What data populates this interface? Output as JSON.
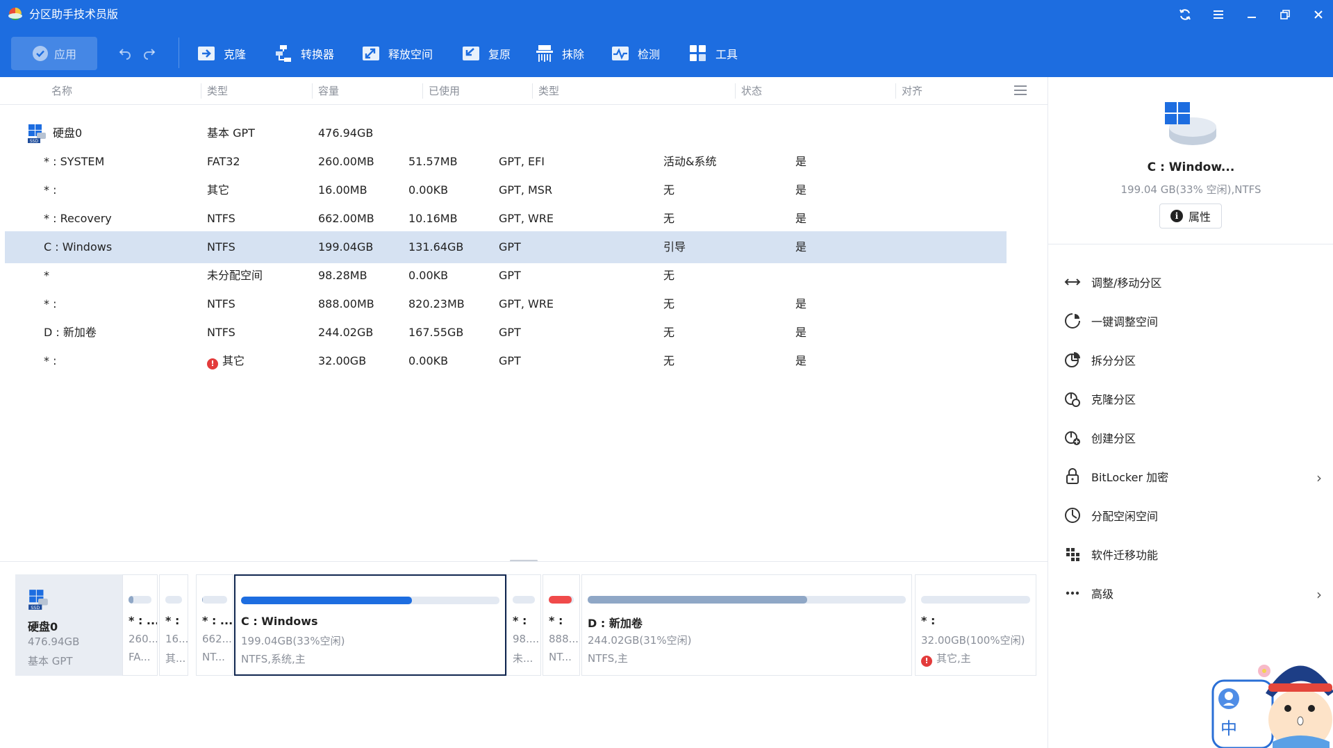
{
  "app": {
    "title": "分区助手技术员版"
  },
  "toolbar": {
    "apply": "应用",
    "tools": [
      {
        "id": "clone",
        "label": "克隆"
      },
      {
        "id": "converter",
        "label": "转换器"
      },
      {
        "id": "free-space",
        "label": "释放空间"
      },
      {
        "id": "restore",
        "label": "复原"
      },
      {
        "id": "wipe",
        "label": "抹除"
      },
      {
        "id": "check",
        "label": "检测"
      },
      {
        "id": "tools",
        "label": "工具"
      }
    ]
  },
  "columns": [
    "名称",
    "类型",
    "容量",
    "已使用",
    "类型",
    "状态",
    "对齐"
  ],
  "disk": {
    "name": "硬盘0",
    "type": "基本 GPT",
    "capacity": "476.94GB",
    "badge": "SSD"
  },
  "partitions": [
    {
      "name": "* : SYSTEM",
      "fs": "FAT32",
      "capacity": "260.00MB",
      "used": "51.57MB",
      "ptype": "GPT, EFI",
      "status": "活动&系统",
      "align": "是"
    },
    {
      "name": "* :",
      "fs": "其它",
      "capacity": "16.00MB",
      "used": "0.00KB",
      "ptype": "GPT, MSR",
      "status": "无",
      "align": "是"
    },
    {
      "name": "* : Recovery",
      "fs": "NTFS",
      "capacity": "662.00MB",
      "used": "10.16MB",
      "ptype": "GPT, WRE",
      "status": "无",
      "align": "是"
    },
    {
      "name": "C : Windows",
      "fs": "NTFS",
      "capacity": "199.04GB",
      "used": "131.64GB",
      "ptype": "GPT",
      "status": "引导",
      "align": "是",
      "selected": true
    },
    {
      "name": "*",
      "fs": "未分配空间",
      "capacity": "98.28MB",
      "used": "0.00KB",
      "ptype": "GPT",
      "status": "无",
      "align": ""
    },
    {
      "name": "* :",
      "fs": "NTFS",
      "capacity": "888.00MB",
      "used": "820.23MB",
      "ptype": "GPT, WRE",
      "status": "无",
      "align": "是"
    },
    {
      "name": "D : 新加卷",
      "fs": "NTFS",
      "capacity": "244.02GB",
      "used": "167.55GB",
      "ptype": "GPT",
      "status": "无",
      "align": "是"
    },
    {
      "name": "* :",
      "fs": "其它",
      "capacity": "32.00GB",
      "used": "0.00KB",
      "ptype": "GPT",
      "status": "无",
      "align": "是",
      "error": true
    }
  ],
  "diskmap": {
    "disk_name": "硬盘0",
    "disk_size": "476.94GB",
    "disk_type": "基本 GPT",
    "cards": [
      {
        "name": "* : ...",
        "line1": "260....",
        "line2": "FA...",
        "fill": 0.2,
        "color": "#8fa7c6"
      },
      {
        "name": "* :",
        "line1": "16....",
        "line2": "其...",
        "fill": 0.0,
        "color": "#8fa7c6"
      },
      {
        "name": "* : ...",
        "line1": "662....",
        "line2": "NT...",
        "fill": 0.02,
        "color": "#8fa7c6"
      },
      {
        "name": "C : Windows",
        "line1": "199.04GB(33%空闲)",
        "line2": "NTFS,系统,主",
        "fill": 0.66,
        "color": "#1d6de0",
        "selected": true
      },
      {
        "name": "* :",
        "line1": "98....",
        "line2": "未...",
        "fill": 0.0,
        "color": "#8fa7c6"
      },
      {
        "name": "* :",
        "line1": "888....",
        "line2": "NT...",
        "fill": 0.92,
        "color": "#f04a4a"
      },
      {
        "name": "D : 新加卷",
        "line1": "244.02GB(31%空闲)",
        "line2": "NTFS,主",
        "fill": 0.69,
        "color": "#8fa7c6"
      },
      {
        "name": "* :",
        "line1": "32.00GB(100%空闲)",
        "line2": "其它,主",
        "fill": 0.0,
        "color": "#8fa7c6",
        "error": true
      }
    ]
  },
  "right_panel": {
    "title": "C : Window...",
    "subtitle": "199.04 GB(33% 空闲),NTFS",
    "properties": "属性",
    "operations": [
      {
        "icon": "resize-move-icon",
        "label": "调整/移动分区"
      },
      {
        "icon": "one-click-adjust-icon",
        "label": "一键调整空间"
      },
      {
        "icon": "split-partition-icon",
        "label": "拆分分区"
      },
      {
        "icon": "clone-partition-icon",
        "label": "克隆分区"
      },
      {
        "icon": "create-partition-icon",
        "label": "创建分区"
      },
      {
        "icon": "lock-icon",
        "label": "BitLocker 加密",
        "chevron": true
      },
      {
        "icon": "allocate-space-icon",
        "label": "分配空闲空间"
      },
      {
        "icon": "app-migration-icon",
        "label": "软件迁移功能"
      },
      {
        "icon": "more-icon",
        "label": "高级",
        "chevron": true
      }
    ]
  },
  "mascot": {
    "lang": "中"
  }
}
